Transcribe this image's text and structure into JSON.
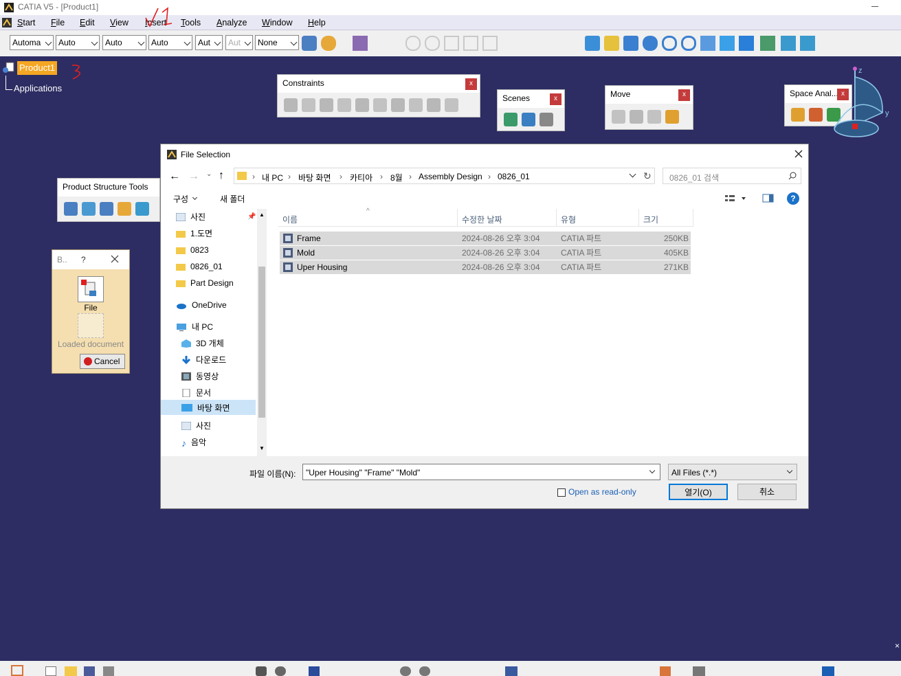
{
  "window": {
    "title": "CATIA V5 - [Product1]"
  },
  "menu": {
    "items": [
      "Start",
      "File",
      "Edit",
      "View",
      "Insert",
      "Tools",
      "Analyze",
      "Window",
      "Help"
    ]
  },
  "toolbar": {
    "combos": [
      "Automa",
      "Auto",
      "Auto",
      "Auto",
      "Aut",
      "Aut",
      "None"
    ]
  },
  "tree": {
    "root": "Product1",
    "child": "Applications"
  },
  "panels": {
    "constraints": {
      "title": "Constraints"
    },
    "scenes": {
      "title": "Scenes"
    },
    "move": {
      "title": "Move"
    },
    "space": {
      "title": "Space Anal..."
    },
    "product_structure": {
      "title": "Product Structure Tools"
    },
    "close_glyph": "x"
  },
  "small_dialog": {
    "title": "B..",
    "help": "?",
    "file_label": "File",
    "loaded_label": "Loaded document",
    "cancel": "Cancel"
  },
  "compass": {
    "z": "z",
    "y": "y"
  },
  "file_dialog": {
    "title": "File Selection",
    "breadcrumb": [
      "내 PC",
      "바탕 화면",
      "카티아",
      "8월",
      "Assembly Design",
      "0826_01"
    ],
    "search_placeholder": "0826_01 검색",
    "organize": "구성",
    "new_folder": "새 폴더",
    "columns": {
      "name": "이름",
      "date": "수정한 날짜",
      "type": "유형",
      "size": "크기"
    },
    "nav": [
      {
        "label": "사진",
        "icon": "picture-icon"
      },
      {
        "label": "1.도면",
        "icon": "folder-icon"
      },
      {
        "label": "0823",
        "icon": "folder-icon"
      },
      {
        "label": "0826_01",
        "icon": "folder-icon"
      },
      {
        "label": "Part Design",
        "icon": "folder-icon"
      },
      {
        "label": "OneDrive",
        "icon": "cloud-icon"
      },
      {
        "label": "내 PC",
        "icon": "pc-icon"
      },
      {
        "label": "3D 개체",
        "icon": "cube-icon"
      },
      {
        "label": "다운로드",
        "icon": "download-icon"
      },
      {
        "label": "동영상",
        "icon": "video-icon"
      },
      {
        "label": "문서",
        "icon": "document-icon"
      },
      {
        "label": "바탕 화면",
        "icon": "desktop-icon"
      },
      {
        "label": "사진",
        "icon": "picture-icon"
      },
      {
        "label": "음악",
        "icon": "music-icon"
      }
    ],
    "files": [
      {
        "name": "Frame",
        "date": "2024-08-26 오후 3:04",
        "type": "CATIA 파트",
        "size": "250KB"
      },
      {
        "name": "Mold",
        "date": "2024-08-26 오후 3:04",
        "type": "CATIA 파트",
        "size": "405KB"
      },
      {
        "name": "Uper Housing",
        "date": "2024-08-26 오후 3:04",
        "type": "CATIA 파트",
        "size": "271KB"
      }
    ],
    "filename_label": "파일 이름(N):",
    "filename_value": "\"Uper Housing\" \"Frame\" \"Mold\"",
    "filter": "All Files (*.*)",
    "readonly_label": "Open as read-only",
    "open_button": "열기(O)",
    "cancel_button": "취소"
  },
  "annotations": {
    "one": "1",
    "three": "3"
  },
  "colors": {
    "background": "#2d2d63",
    "selection": "#f5a623",
    "link": "#1a5fb4",
    "annotation": "#e02020"
  }
}
